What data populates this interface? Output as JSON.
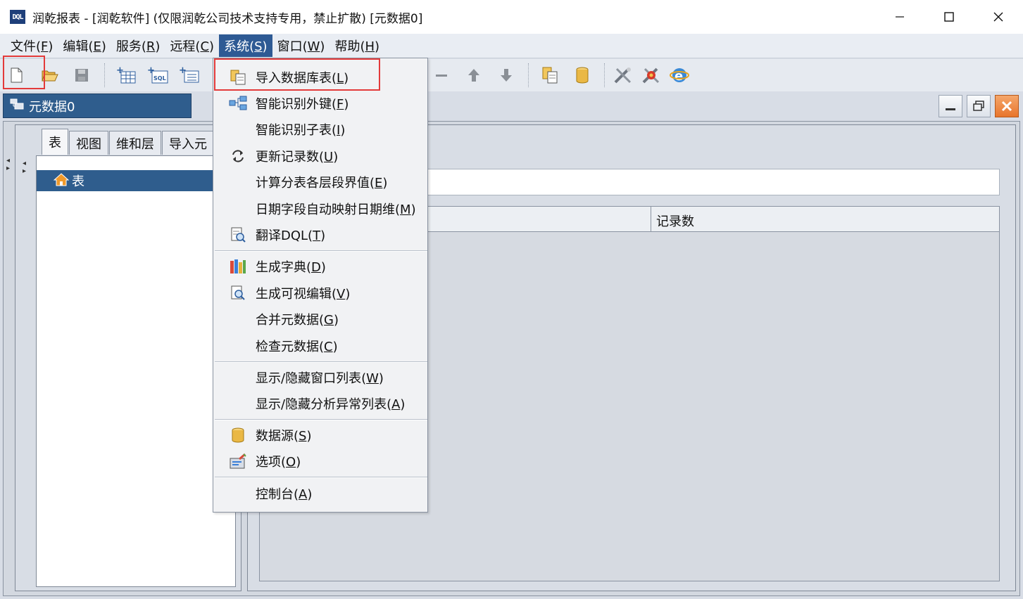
{
  "window": {
    "title": "润乾报表 - [润乾软件] (仅限润乾公司技术支持专用，禁止扩散) [元数据0]",
    "logo_text": "DQL",
    "minimize_glyph": "—",
    "maximize_glyph": "☐",
    "close_glyph": "✕"
  },
  "menubar": [
    {
      "label": "文件(",
      "acc": "F",
      "tail": ")"
    },
    {
      "label": "编辑(",
      "acc": "E",
      "tail": ")"
    },
    {
      "label": "服务(",
      "acc": "R",
      "tail": ")"
    },
    {
      "label": "远程(",
      "acc": "C",
      "tail": ")"
    },
    {
      "label": "系统(",
      "acc": "S",
      "tail": ")",
      "active": true
    },
    {
      "label": "窗口(",
      "acc": "W",
      "tail": ")"
    },
    {
      "label": "帮助(",
      "acc": "H",
      "tail": ")"
    }
  ],
  "inner_window": {
    "title": "元数据0"
  },
  "tabs": [
    "表",
    "视图",
    "维和层",
    "导入元"
  ],
  "tree": {
    "root_label": "表"
  },
  "grid": {
    "column2_header": "记录数"
  },
  "system_menu": {
    "items": [
      {
        "label": "导入数据库表(",
        "acc": "L",
        "tail": ")",
        "icon": "import-table-icon"
      },
      {
        "label": "智能识别外键(",
        "acc": "F",
        "tail": ")",
        "icon": "foreign-key-icon"
      },
      {
        "label": "智能识别子表(",
        "acc": "I",
        "tail": ")",
        "icon": ""
      },
      {
        "label": "更新记录数(",
        "acc": "U",
        "tail": ")",
        "icon": "refresh-icon"
      },
      {
        "label": "计算分表各层段界值(",
        "acc": "E",
        "tail": ")",
        "icon": ""
      },
      {
        "label": "日期字段自动映射日期维(",
        "acc": "M",
        "tail": ")",
        "icon": ""
      },
      {
        "label": "翻译DQL(",
        "acc": "T",
        "tail": ")",
        "icon": "translate-dql-icon"
      },
      {
        "label": "生成字典(",
        "acc": "D",
        "tail": ")",
        "icon": "dictionary-icon"
      },
      {
        "label": "生成可视编辑(",
        "acc": "V",
        "tail": ")",
        "icon": "visual-edit-icon"
      },
      {
        "label": "合并元数据(",
        "acc": "G",
        "tail": ")",
        "icon": ""
      },
      {
        "label": "检查元数据(",
        "acc": "C",
        "tail": ")",
        "icon": ""
      },
      {
        "label": "显示/隐藏窗口列表(",
        "acc": "W",
        "tail": ")",
        "icon": ""
      },
      {
        "label": "显示/隐藏分析异常列表(",
        "acc": "A",
        "tail": ")",
        "icon": ""
      },
      {
        "label": "数据源(",
        "acc": "S",
        "tail": ")",
        "icon": "datasource-icon"
      },
      {
        "label": "选项(",
        "acc": "O",
        "tail": ")",
        "icon": "options-icon"
      },
      {
        "label": "控制台(",
        "acc": "A",
        "tail": ")",
        "icon": ""
      }
    ]
  },
  "colors": {
    "highlight_box": "#e33a3a",
    "selection_blue": "#2f5d8d"
  }
}
